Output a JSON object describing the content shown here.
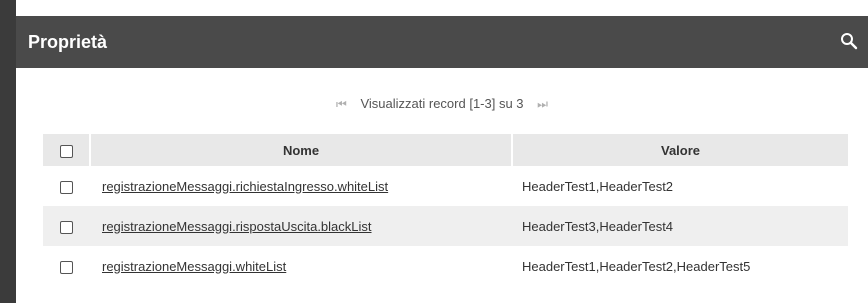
{
  "header": {
    "title": "Proprietà",
    "search_icon": "search-icon"
  },
  "pager": {
    "first_icon": "first-page-icon",
    "label": "Visualizzati record [1-3] su 3",
    "last_icon": "last-page-icon"
  },
  "table": {
    "columns": {
      "name": "Nome",
      "value": "Valore"
    },
    "rows": [
      {
        "name": "registrazioneMessaggi.richiestaIngresso.whiteList",
        "value": "HeaderTest1,HeaderTest2"
      },
      {
        "name": "registrazioneMessaggi.rispostaUscita.blackList",
        "value": "HeaderTest3,HeaderTest4"
      },
      {
        "name": "registrazioneMessaggi.whiteList",
        "value": "HeaderTest1,HeaderTest2,HeaderTest5"
      }
    ]
  }
}
